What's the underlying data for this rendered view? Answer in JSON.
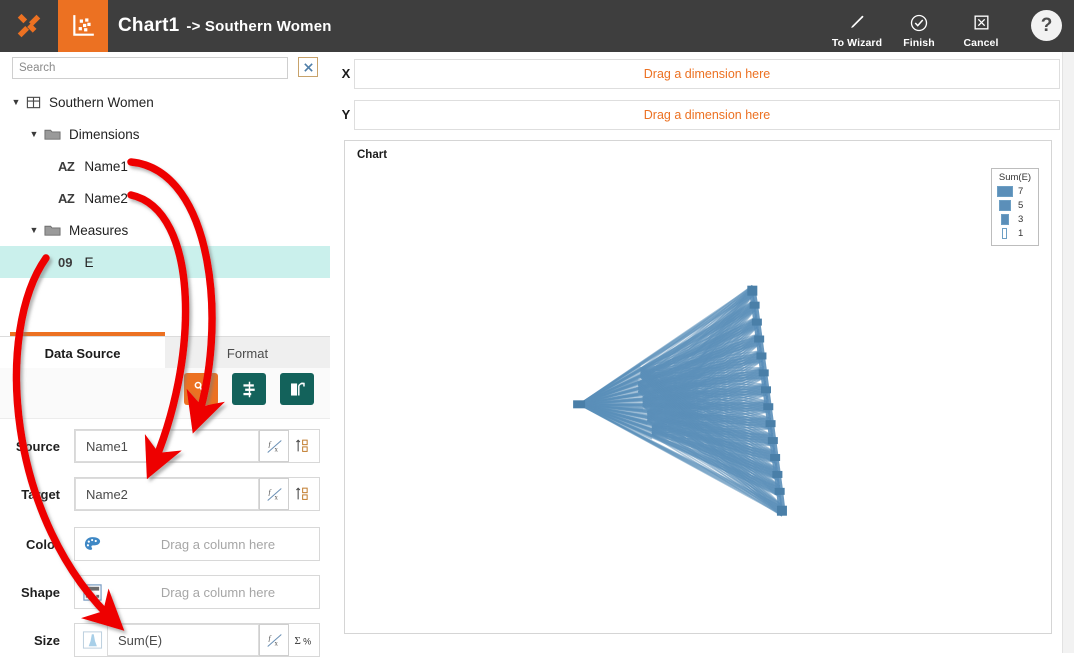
{
  "header": {
    "logo_icon": "puzzle-logo-icon",
    "chart_tab_icon": "scatter-chart-icon",
    "title": "Chart1",
    "subtitle": "-> Southern Women",
    "tools": [
      {
        "label": "To Wizard",
        "icon": "pencil-icon"
      },
      {
        "label": "Finish",
        "icon": "check-circle-icon"
      },
      {
        "label": "Cancel",
        "icon": "x-box-icon"
      }
    ],
    "help_label": "?"
  },
  "sidebar": {
    "search": {
      "value": "",
      "placeholder": "Search"
    },
    "clear_label": "✕",
    "tree": [
      {
        "label": "Southern Women",
        "icon": "table-icon",
        "kind": "dataset",
        "depth": 0,
        "expanded": true,
        "selected": false
      },
      {
        "label": "Dimensions",
        "icon": "folder-icon",
        "kind": "folder",
        "depth": 1,
        "expanded": true,
        "selected": false
      },
      {
        "label": "Name1",
        "icon": "az-icon",
        "kind": "field",
        "depth": 2,
        "badge": "AZ",
        "selected": false
      },
      {
        "label": "Name2",
        "icon": "az-icon",
        "kind": "field",
        "depth": 2,
        "badge": "AZ",
        "selected": false
      },
      {
        "label": "Measures",
        "icon": "folder-icon",
        "kind": "folder",
        "depth": 1,
        "expanded": true,
        "selected": false
      },
      {
        "label": "E",
        "icon": "number-icon",
        "kind": "field",
        "depth": 2,
        "badge": "09",
        "selected": true
      }
    ],
    "tabs": [
      {
        "label": "Data Source",
        "active": true
      },
      {
        "label": "Format",
        "active": false
      }
    ]
  },
  "datasource": {
    "toolbar": [
      {
        "name": "network-layout-button",
        "icon": "network-icon",
        "color": "#ec7122",
        "active": true
      },
      {
        "name": "align-button",
        "icon": "align-icon",
        "color": "#13625b",
        "active": false
      },
      {
        "name": "transpose-button",
        "icon": "flip-icon",
        "color": "#13625b",
        "active": false
      }
    ],
    "shelves": [
      {
        "label": "Source",
        "value": "Name1",
        "placeholder": "",
        "lead_icon": null,
        "trail_icons": [
          "formula-icon",
          "sort-icon"
        ]
      },
      {
        "label": "Target",
        "value": "Name2",
        "placeholder": "",
        "lead_icon": null,
        "trail_icons": [
          "formula-icon",
          "sort-icon"
        ]
      },
      {
        "label": "Color",
        "value": "",
        "placeholder": "Drag a column here",
        "lead_icon": "palette-icon",
        "trail_icons": []
      },
      {
        "label": "Shape",
        "value": "",
        "placeholder": "Drag a column here",
        "lead_icon": "shape-icon",
        "trail_icons": []
      },
      {
        "label": "Size",
        "value": "Sum(E)",
        "placeholder": "",
        "lead_icon": "size-gradient-icon",
        "trail_icons": [
          "formula-icon",
          "sigma-percent-icon"
        ]
      }
    ]
  },
  "dropzones": [
    {
      "axis": "X",
      "placeholder": "Drag a dimension here"
    },
    {
      "axis": "Y",
      "placeholder": "Drag a dimension here"
    }
  ],
  "chart_panel": {
    "title": "Chart",
    "legend": {
      "title": "Sum(E)",
      "items": [
        {
          "value": "7",
          "width": 16
        },
        {
          "value": "5",
          "width": 12
        },
        {
          "value": "3",
          "width": 8
        },
        {
          "value": "1",
          "width": 5
        }
      ]
    }
  },
  "chart_data": {
    "type": "network",
    "title": "Chart",
    "edge_color": "#5b8fb9",
    "node_color": "#4a7fa8",
    "legend_title": "Sum(E)",
    "legend_values": [
      7,
      5,
      3,
      1
    ],
    "source_field": "Name1",
    "target_field": "Name2",
    "size_field": "Sum(E)",
    "description": "Dense bipartite-like edge bundle: one hub node at the left converges edges that fan out to a vertical chain of nodes along the right side",
    "nodes": [
      {
        "id": "hub",
        "x": 0.04,
        "y": 0.51
      },
      {
        "id": "t01",
        "x": 0.8,
        "y": 0.04
      },
      {
        "id": "t02",
        "x": 0.81,
        "y": 0.1
      },
      {
        "id": "t03",
        "x": 0.82,
        "y": 0.17
      },
      {
        "id": "t04",
        "x": 0.83,
        "y": 0.24
      },
      {
        "id": "t05",
        "x": 0.84,
        "y": 0.31
      },
      {
        "id": "t06",
        "x": 0.85,
        "y": 0.38
      },
      {
        "id": "t07",
        "x": 0.86,
        "y": 0.45
      },
      {
        "id": "t08",
        "x": 0.87,
        "y": 0.52
      },
      {
        "id": "t09",
        "x": 0.88,
        "y": 0.59
      },
      {
        "id": "t10",
        "x": 0.89,
        "y": 0.66
      },
      {
        "id": "t11",
        "x": 0.9,
        "y": 0.73
      },
      {
        "id": "t12",
        "x": 0.91,
        "y": 0.8
      },
      {
        "id": "t13",
        "x": 0.92,
        "y": 0.87
      },
      {
        "id": "t14",
        "x": 0.93,
        "y": 0.95
      },
      {
        "id": "m01",
        "x": 0.3,
        "y": 0.44
      },
      {
        "id": "m02",
        "x": 0.32,
        "y": 0.5
      },
      {
        "id": "m03",
        "x": 0.34,
        "y": 0.56
      },
      {
        "id": "m04",
        "x": 0.36,
        "y": 0.62
      },
      {
        "id": "m05",
        "x": 0.31,
        "y": 0.38
      }
    ]
  },
  "annotations": {
    "arrow_color": "#ee0000",
    "arrows": [
      {
        "from": "tree-field-name1",
        "to": "shelf-source"
      },
      {
        "from": "tree-field-name2",
        "to": "shelf-target"
      },
      {
        "from": "tree-field-e",
        "to": "shelf-size"
      }
    ]
  }
}
